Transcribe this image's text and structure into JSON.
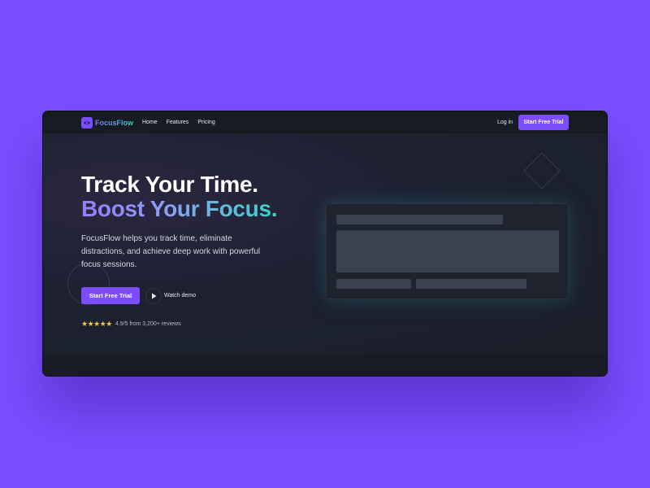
{
  "nav": {
    "logo_text": "FocusFlow",
    "links": [
      "Home",
      "Features",
      "Pricing"
    ],
    "login_label": "Log in",
    "cta_label": "Start Free Trial"
  },
  "hero": {
    "headline_line1": "Track Your Time.",
    "headline_line2": "Boost Your Focus.",
    "subtext": "FocusFlow helps you track time, eliminate distractions, and achieve deep work with powerful focus sessions.",
    "cta_label": "Start Free Trial",
    "watch_demo_label": "Watch demo",
    "stars": "★★★★★",
    "rating_text": "4.9/5 from 3,200+ reviews"
  },
  "colors": {
    "accent": "#7b4dff",
    "teal": "#3cd3c6",
    "background": "#7b4dff",
    "star": "#f5c542"
  },
  "icons": {
    "logo": "focus-eye-icon",
    "play": "play-icon",
    "star": "star-icon"
  }
}
